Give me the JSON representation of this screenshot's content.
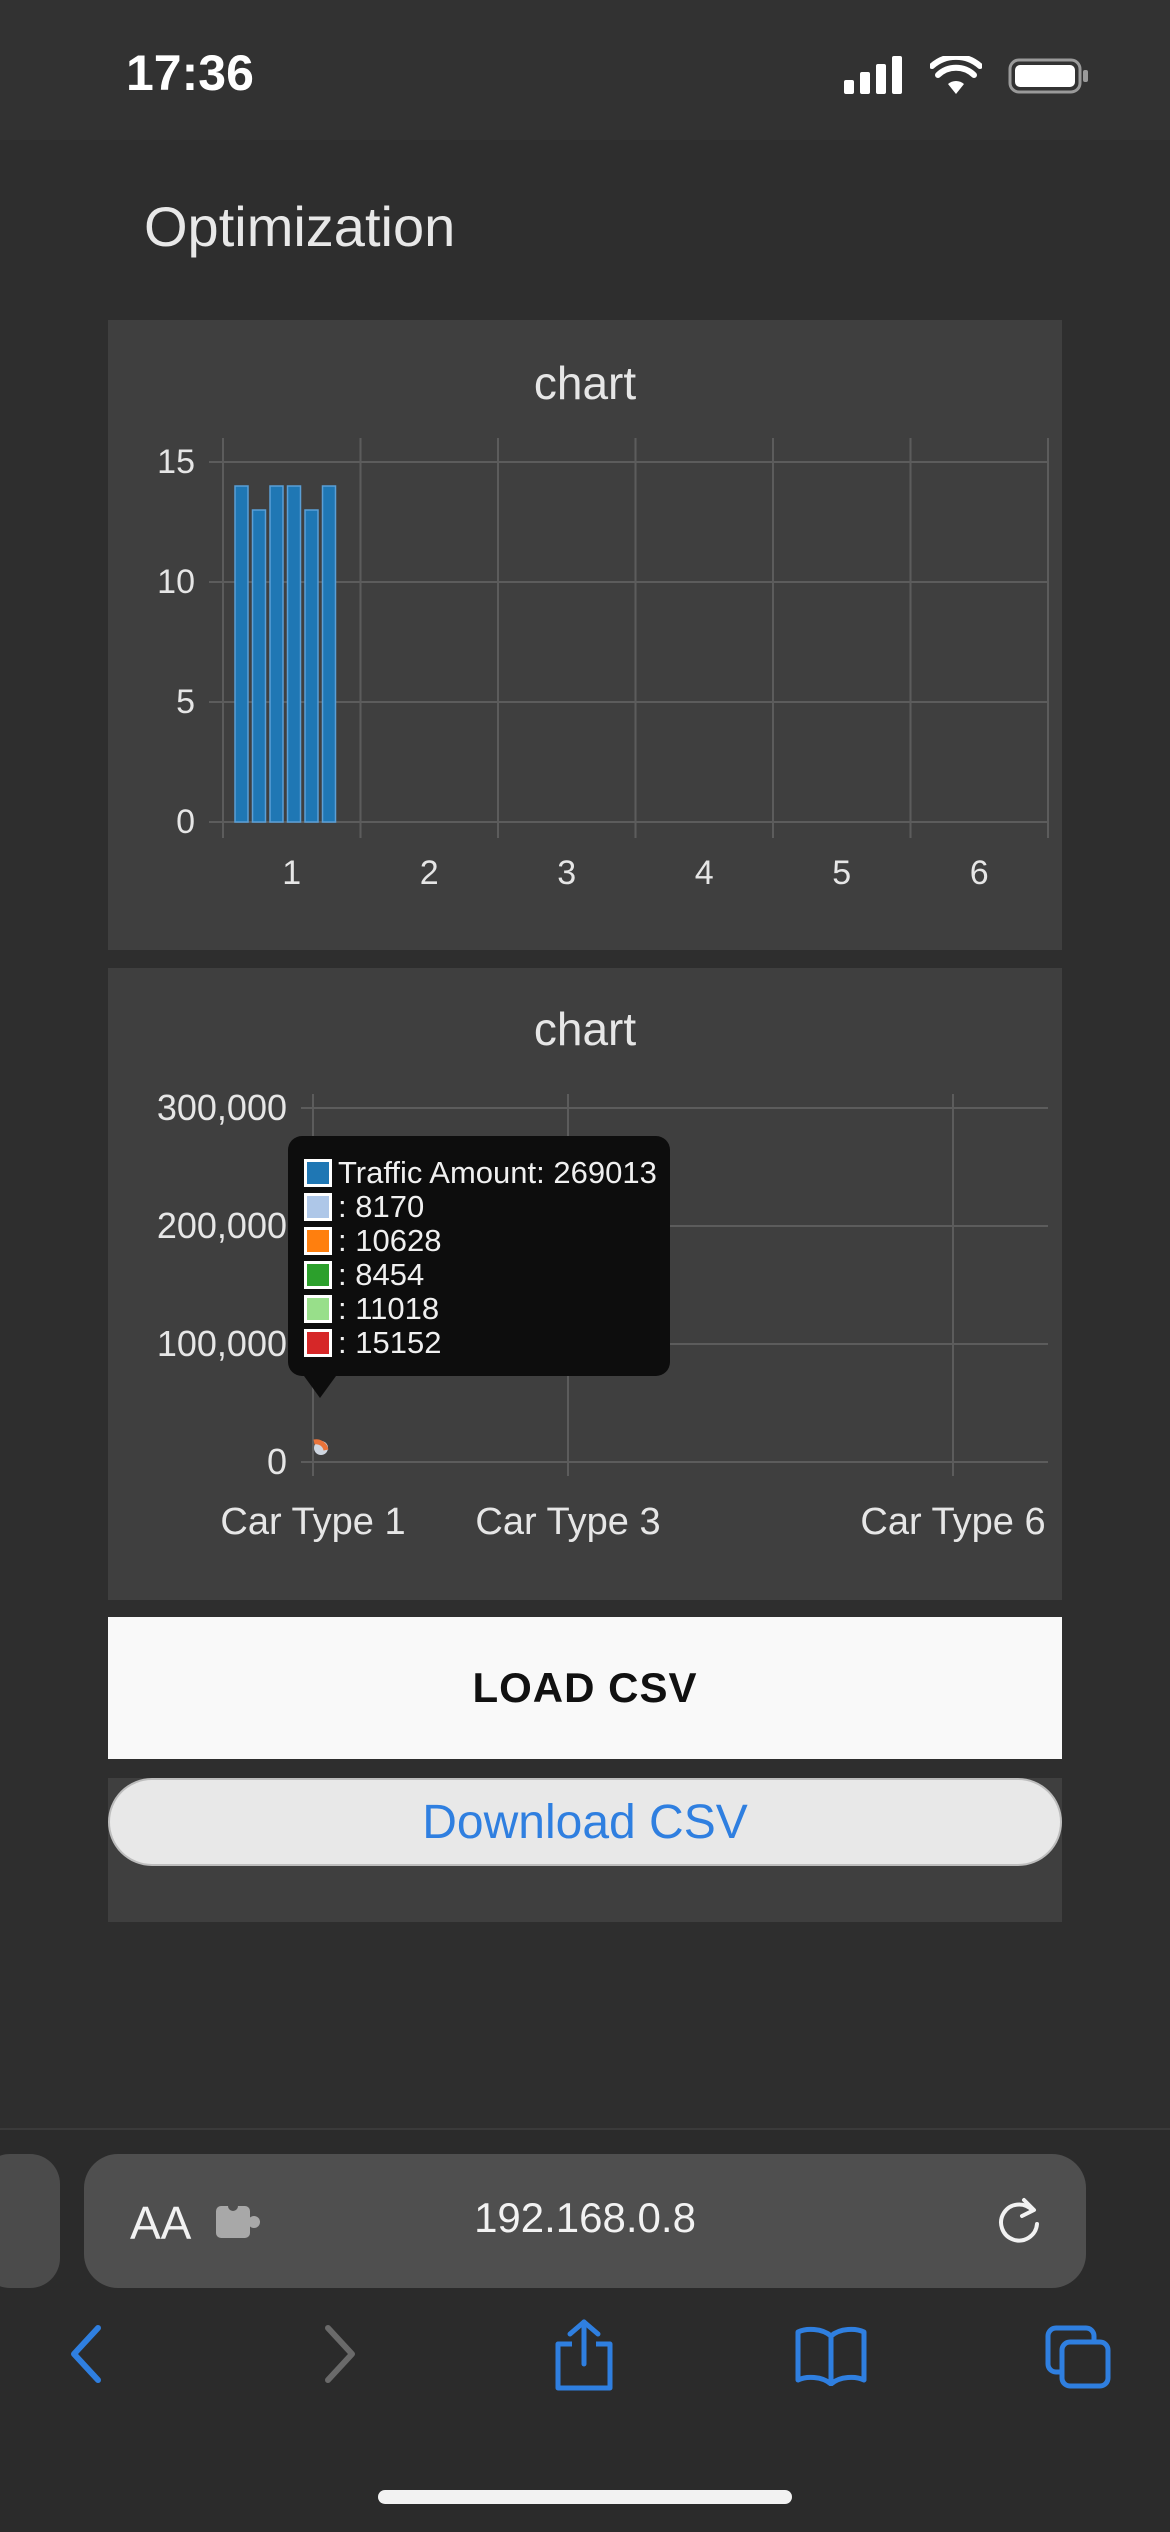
{
  "status": {
    "time": "17:36"
  },
  "page": {
    "title": "Optimization"
  },
  "chart1_title": "chart",
  "chart2_title": "chart",
  "chart_data": [
    {
      "type": "bar",
      "title": "chart",
      "x": [
        1,
        2,
        3,
        4,
        5,
        6
      ],
      "x_ticks": [
        "1",
        "2",
        "3",
        "4",
        "5",
        "6"
      ],
      "y_ticks": [
        "0",
        "5",
        "10",
        "15"
      ],
      "ylim": [
        0,
        15.5
      ],
      "bars_at_x": 1,
      "values": [
        14,
        13,
        14,
        14,
        13,
        14
      ],
      "color": "#1f77b4",
      "grid": true
    },
    {
      "type": "line",
      "title": "chart",
      "categories": [
        "Car Type 1",
        "Car Type 3",
        "Car Type 6"
      ],
      "y_ticks": [
        "0",
        "100,000",
        "200,000",
        "300,000"
      ],
      "ylim": [
        0,
        300000
      ],
      "grid": true,
      "tooltip": {
        "rows": [
          {
            "label": "Traffic Amount: 269013",
            "color": "#1f77b4"
          },
          {
            "label": ": 8170",
            "color": "#aec7e8"
          },
          {
            "label": ": 10628",
            "color": "#ff7f0e"
          },
          {
            "label": ": 8454",
            "color": "#2ca02c"
          },
          {
            "label": ": 11018",
            "color": "#98df8a"
          },
          {
            "label": ": 15152",
            "color": "#d62728"
          }
        ]
      }
    }
  ],
  "actions": {
    "load_csv": "LOAD CSV",
    "download_csv": "Download CSV"
  },
  "browser": {
    "aa": "AA",
    "url": "192.168.0.8"
  },
  "colors": {
    "accent": "#2f7fe0",
    "bar": "#1f77b4"
  }
}
